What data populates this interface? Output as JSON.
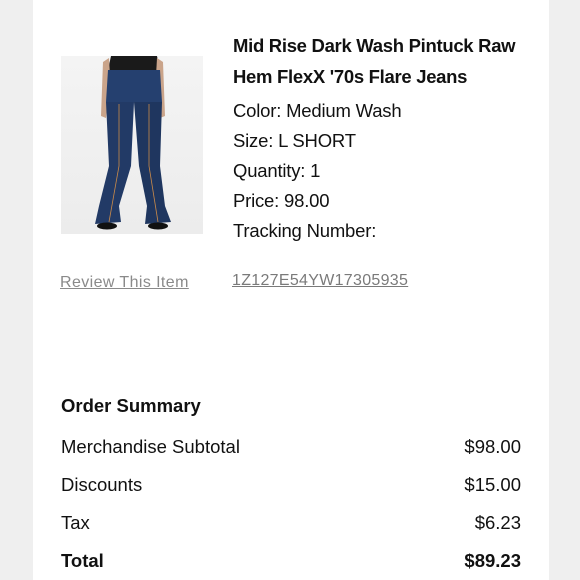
{
  "item": {
    "title": "Mid Rise Dark Wash Pintuck Raw Hem FlexX '70s Flare Jeans",
    "color": "Color: Medium Wash",
    "size": "Size: L SHORT",
    "quantity": "Quantity: 1",
    "price": "Price: 98.00",
    "tracking_label": "Tracking Number:",
    "tracking_number": "1Z127E54YW17305935",
    "review_link": "Review This Item",
    "image_icon": "jeans-product-photo"
  },
  "summary": {
    "heading": "Order Summary",
    "rows": [
      {
        "label": "Merchandise Subtotal",
        "value": "$98.00"
      },
      {
        "label": "Discounts",
        "value": "$15.00"
      },
      {
        "label": "Tax",
        "value": "$6.23"
      }
    ],
    "total": {
      "label": "Total",
      "value": "$89.23"
    }
  },
  "colors": {
    "background": "#efefef",
    "card": "#ffffff",
    "link_gray": "#8a8a8a",
    "denim": "#223a66"
  }
}
